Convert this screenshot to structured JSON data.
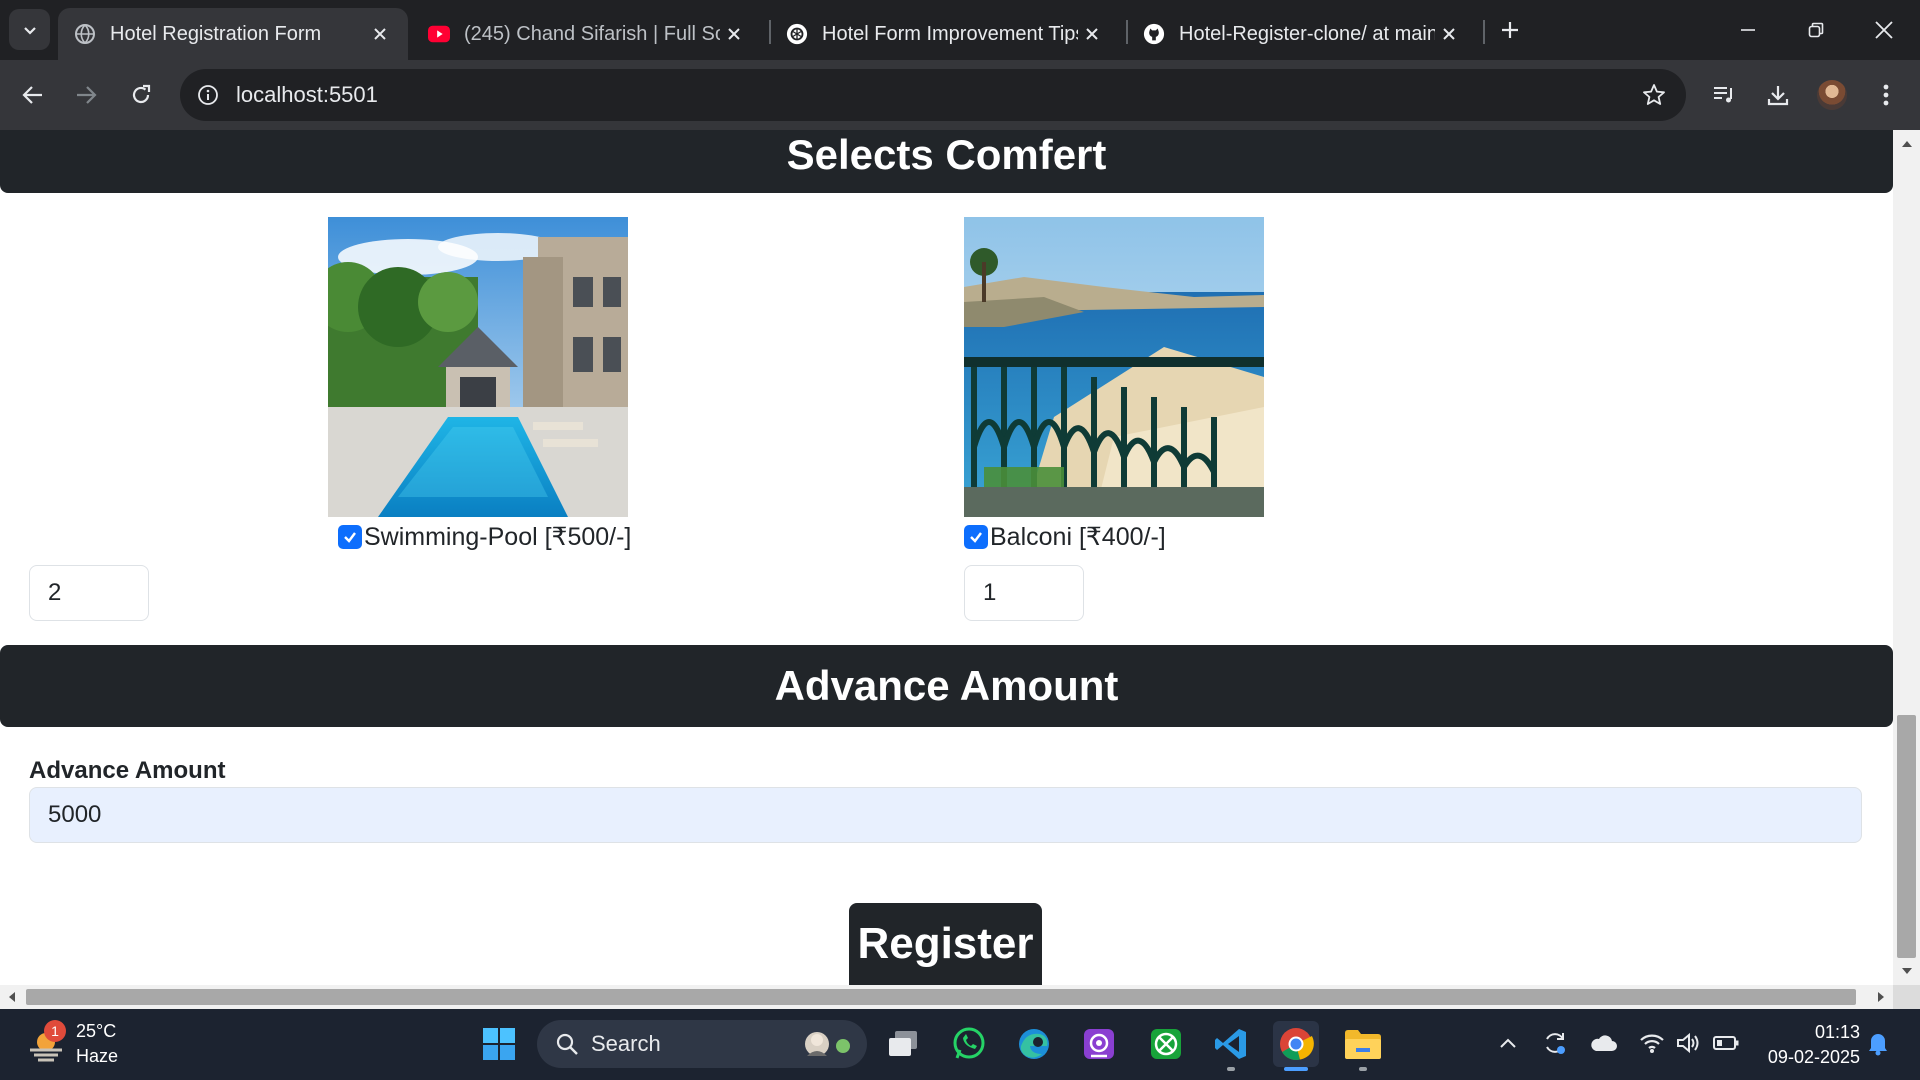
{
  "browser": {
    "tabs": [
      {
        "title": "Hotel Registration Form",
        "active": true
      },
      {
        "title": "(245) Chand Sifarish | Full Song",
        "active": false
      },
      {
        "title": "Hotel Form Improvement Tips",
        "active": false
      },
      {
        "title": "Hotel-Register-clone/ at main ·",
        "active": false
      }
    ],
    "url": "localhost:5501"
  },
  "page": {
    "comfort_heading": "Selects Comfert",
    "amenities": [
      {
        "label": "Swimming-Pool [₹500/-]",
        "checked": true,
        "quantity": "2"
      },
      {
        "label": "Balconi [₹400/-]",
        "checked": true,
        "quantity": "1"
      }
    ],
    "advance_heading": "Advance Amount",
    "advance_label": "Advance Amount",
    "advance_value": "5000",
    "register_label": "Register"
  },
  "taskbar": {
    "weather_temp": "25°C",
    "weather_desc": "Haze",
    "weather_badge": "1",
    "search_label": "Search",
    "time": "01:13",
    "date": "09-02-2025"
  },
  "colors": {
    "dark_bar": "#212529",
    "checkbox": "#0d6efd",
    "autofill": "#e8f0fe",
    "taskbar": "#1c2330"
  }
}
